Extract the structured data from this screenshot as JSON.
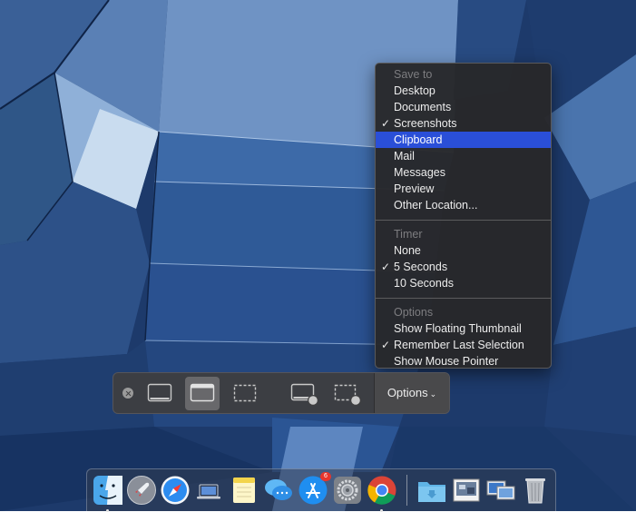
{
  "menu": {
    "save_to": {
      "header": "Save to",
      "items": [
        {
          "label": "Desktop",
          "checked": false,
          "highlighted": false
        },
        {
          "label": "Documents",
          "checked": false,
          "highlighted": false
        },
        {
          "label": "Screenshots",
          "checked": true,
          "highlighted": false
        },
        {
          "label": "Clipboard",
          "checked": false,
          "highlighted": true
        },
        {
          "label": "Mail",
          "checked": false,
          "highlighted": false
        },
        {
          "label": "Messages",
          "checked": false,
          "highlighted": false
        },
        {
          "label": "Preview",
          "checked": false,
          "highlighted": false
        },
        {
          "label": "Other Location...",
          "checked": false,
          "highlighted": false
        }
      ]
    },
    "timer": {
      "header": "Timer",
      "items": [
        {
          "label": "None",
          "checked": false
        },
        {
          "label": "5 Seconds",
          "checked": true
        },
        {
          "label": "10 Seconds",
          "checked": false
        }
      ]
    },
    "options": {
      "header": "Options",
      "items": [
        {
          "label": "Show Floating Thumbnail",
          "checked": false
        },
        {
          "label": "Remember Last Selection",
          "checked": true
        },
        {
          "label": "Show Mouse Pointer",
          "checked": false
        }
      ]
    },
    "checkmark": "✓"
  },
  "toolbar": {
    "options_label": "Options",
    "options_chevron": "⌄",
    "buttons": [
      {
        "name": "capture-entire-screen",
        "icon": "screen-icon",
        "active": false
      },
      {
        "name": "capture-selected-window",
        "icon": "window-icon",
        "active": true
      },
      {
        "name": "capture-selected-portion",
        "icon": "selection-icon",
        "active": false
      },
      {
        "name": "record-entire-screen",
        "icon": "record-screen-icon",
        "active": false
      },
      {
        "name": "record-selected-portion",
        "icon": "record-selection-icon",
        "active": false
      }
    ]
  },
  "dock": {
    "apps": [
      {
        "name": "finder",
        "running": true
      },
      {
        "name": "launchpad",
        "running": false
      },
      {
        "name": "safari",
        "running": false
      },
      {
        "name": "macbook",
        "running": false
      },
      {
        "name": "notes",
        "running": false
      },
      {
        "name": "messages",
        "running": false
      },
      {
        "name": "app-store",
        "running": false,
        "badge": "6"
      },
      {
        "name": "system-preferences",
        "running": false
      },
      {
        "name": "chrome",
        "running": true
      }
    ],
    "stacks": [
      "downloads-folder",
      "preview",
      "screen-sharing",
      "trash"
    ]
  },
  "colors": {
    "menu_highlight": "#2a4fd8",
    "menu_bg": "#28282a",
    "toolbar_bg": "#3e3e40",
    "wallpaper_sky": "#6d8fbc"
  }
}
